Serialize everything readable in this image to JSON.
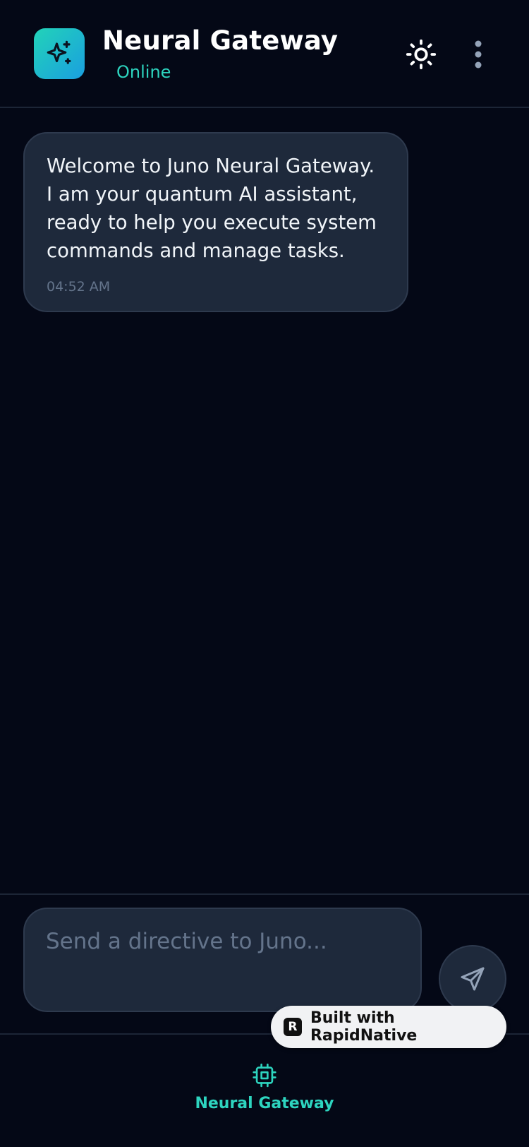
{
  "header": {
    "title": "Neural Gateway",
    "status": "Online",
    "logo_icon": "sparkles-icon",
    "theme_icon": "sun-icon",
    "menu_icon": "more-vertical-icon"
  },
  "messages": [
    {
      "text": "Welcome to Juno Neural Gateway. I am your quantum AI assistant, ready to help you execute system commands and manage tasks.",
      "time": "04:52 AM"
    }
  ],
  "composer": {
    "placeholder": "Send a directive to Juno...",
    "value": "",
    "send_icon": "send-icon"
  },
  "badge": {
    "label": "Built with RapidNative",
    "logo_letter": "R"
  },
  "bottom_nav": {
    "items": [
      {
        "label": "Neural Gateway",
        "icon": "cpu-icon",
        "active": true
      }
    ]
  },
  "colors": {
    "background": "#040816",
    "accent": "#2dd4bf",
    "bubble": "#1e293b",
    "border": "#2e3a4e",
    "muted": "#64748b"
  }
}
